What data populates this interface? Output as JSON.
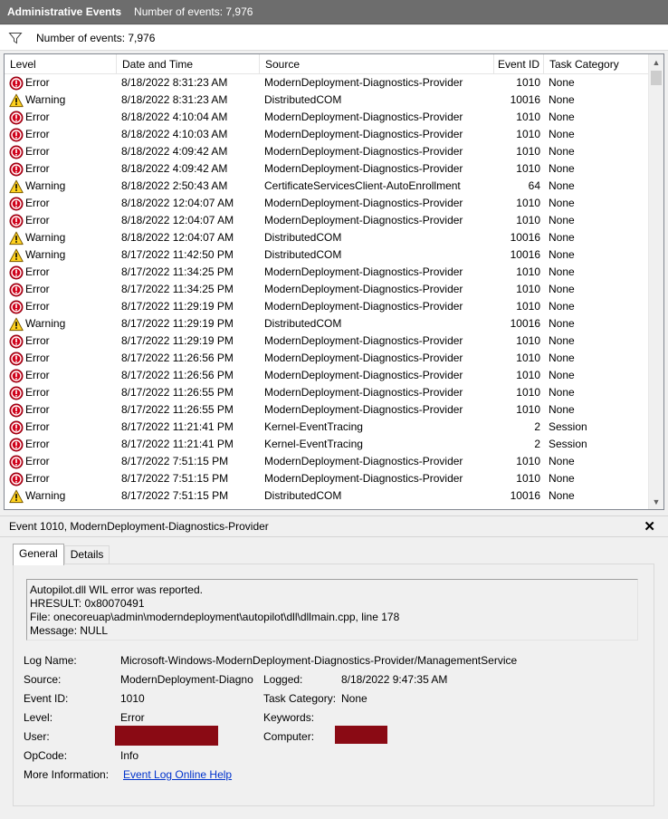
{
  "title": {
    "section": "Administrative Events",
    "count": "Number of events: 7,976"
  },
  "filter": {
    "icon": "filter-icon",
    "text": "Number of events: 7,976"
  },
  "columns": [
    "Level",
    "Date and Time",
    "Source",
    "Event ID",
    "Task Category"
  ],
  "events": [
    {
      "level": "Error",
      "date": "8/18/2022 8:31:23 AM",
      "source": "ModernDeployment-Diagnostics-Provider",
      "id": "1010",
      "category": "None"
    },
    {
      "level": "Warning",
      "date": "8/18/2022 8:31:23 AM",
      "source": "DistributedCOM",
      "id": "10016",
      "category": "None"
    },
    {
      "level": "Error",
      "date": "8/18/2022 4:10:04 AM",
      "source": "ModernDeployment-Diagnostics-Provider",
      "id": "1010",
      "category": "None"
    },
    {
      "level": "Error",
      "date": "8/18/2022 4:10:03 AM",
      "source": "ModernDeployment-Diagnostics-Provider",
      "id": "1010",
      "category": "None"
    },
    {
      "level": "Error",
      "date": "8/18/2022 4:09:42 AM",
      "source": "ModernDeployment-Diagnostics-Provider",
      "id": "1010",
      "category": "None"
    },
    {
      "level": "Error",
      "date": "8/18/2022 4:09:42 AM",
      "source": "ModernDeployment-Diagnostics-Provider",
      "id": "1010",
      "category": "None"
    },
    {
      "level": "Warning",
      "date": "8/18/2022 2:50:43 AM",
      "source": "CertificateServicesClient-AutoEnrollment",
      "id": "64",
      "category": "None"
    },
    {
      "level": "Error",
      "date": "8/18/2022 12:04:07 AM",
      "source": "ModernDeployment-Diagnostics-Provider",
      "id": "1010",
      "category": "None"
    },
    {
      "level": "Error",
      "date": "8/18/2022 12:04:07 AM",
      "source": "ModernDeployment-Diagnostics-Provider",
      "id": "1010",
      "category": "None"
    },
    {
      "level": "Warning",
      "date": "8/18/2022 12:04:07 AM",
      "source": "DistributedCOM",
      "id": "10016",
      "category": "None"
    },
    {
      "level": "Warning",
      "date": "8/17/2022 11:42:50 PM",
      "source": "DistributedCOM",
      "id": "10016",
      "category": "None"
    },
    {
      "level": "Error",
      "date": "8/17/2022 11:34:25 PM",
      "source": "ModernDeployment-Diagnostics-Provider",
      "id": "1010",
      "category": "None"
    },
    {
      "level": "Error",
      "date": "8/17/2022 11:34:25 PM",
      "source": "ModernDeployment-Diagnostics-Provider",
      "id": "1010",
      "category": "None"
    },
    {
      "level": "Error",
      "date": "8/17/2022 11:29:19 PM",
      "source": "ModernDeployment-Diagnostics-Provider",
      "id": "1010",
      "category": "None"
    },
    {
      "level": "Warning",
      "date": "8/17/2022 11:29:19 PM",
      "source": "DistributedCOM",
      "id": "10016",
      "category": "None"
    },
    {
      "level": "Error",
      "date": "8/17/2022 11:29:19 PM",
      "source": "ModernDeployment-Diagnostics-Provider",
      "id": "1010",
      "category": "None"
    },
    {
      "level": "Error",
      "date": "8/17/2022 11:26:56 PM",
      "source": "ModernDeployment-Diagnostics-Provider",
      "id": "1010",
      "category": "None"
    },
    {
      "level": "Error",
      "date": "8/17/2022 11:26:56 PM",
      "source": "ModernDeployment-Diagnostics-Provider",
      "id": "1010",
      "category": "None"
    },
    {
      "level": "Error",
      "date": "8/17/2022 11:26:55 PM",
      "source": "ModernDeployment-Diagnostics-Provider",
      "id": "1010",
      "category": "None"
    },
    {
      "level": "Error",
      "date": "8/17/2022 11:26:55 PM",
      "source": "ModernDeployment-Diagnostics-Provider",
      "id": "1010",
      "category": "None"
    },
    {
      "level": "Error",
      "date": "8/17/2022 11:21:41 PM",
      "source": "Kernel-EventTracing",
      "id": "2",
      "category": "Session"
    },
    {
      "level": "Error",
      "date": "8/17/2022 11:21:41 PM",
      "source": "Kernel-EventTracing",
      "id": "2",
      "category": "Session"
    },
    {
      "level": "Error",
      "date": "8/17/2022 7:51:15 PM",
      "source": "ModernDeployment-Diagnostics-Provider",
      "id": "1010",
      "category": "None"
    },
    {
      "level": "Error",
      "date": "8/17/2022 7:51:15 PM",
      "source": "ModernDeployment-Diagnostics-Provider",
      "id": "1010",
      "category": "None"
    },
    {
      "level": "Warning",
      "date": "8/17/2022 7:51:15 PM",
      "source": "DistributedCOM",
      "id": "10016",
      "category": "None"
    }
  ],
  "detail": {
    "header": "Event 1010, ModernDeployment-Diagnostics-Provider",
    "close": "✕",
    "tabs": {
      "general": "General",
      "details": "Details"
    },
    "description": {
      "line1": "Autopilot.dll WIL error was reported.",
      "line2": "HRESULT: 0x80070491",
      "line3": "File: onecoreuap\\admin\\moderndeployment\\autopilot\\dll\\dllmain.cpp, line 178",
      "line4": "Message: NULL"
    },
    "labels": {
      "log_name": "Log Name:",
      "source": "Source:",
      "event_id": "Event ID:",
      "level": "Level:",
      "user": "User:",
      "opcode": "OpCode:",
      "more_info": "More Information:",
      "logged": "Logged:",
      "task_category": "Task Category:",
      "keywords": "Keywords:",
      "computer": "Computer:"
    },
    "values": {
      "log_name": "Microsoft-Windows-ModernDeployment-Diagnostics-Provider/ManagementService",
      "source": "ModernDeployment-Diagno",
      "event_id": "1010",
      "level": "Error",
      "opcode": "Info",
      "more_info": "Event Log Online Help",
      "logged": "8/18/2022 9:47:35 AM",
      "task_category": "None",
      "keywords": ""
    },
    "redaction_color": "#8a0a14"
  },
  "colors": {
    "titlebar": "#6d6d6d",
    "error_red": "#d0021b",
    "warning_yellow": "#ffd21f",
    "link": "#0033cc"
  }
}
